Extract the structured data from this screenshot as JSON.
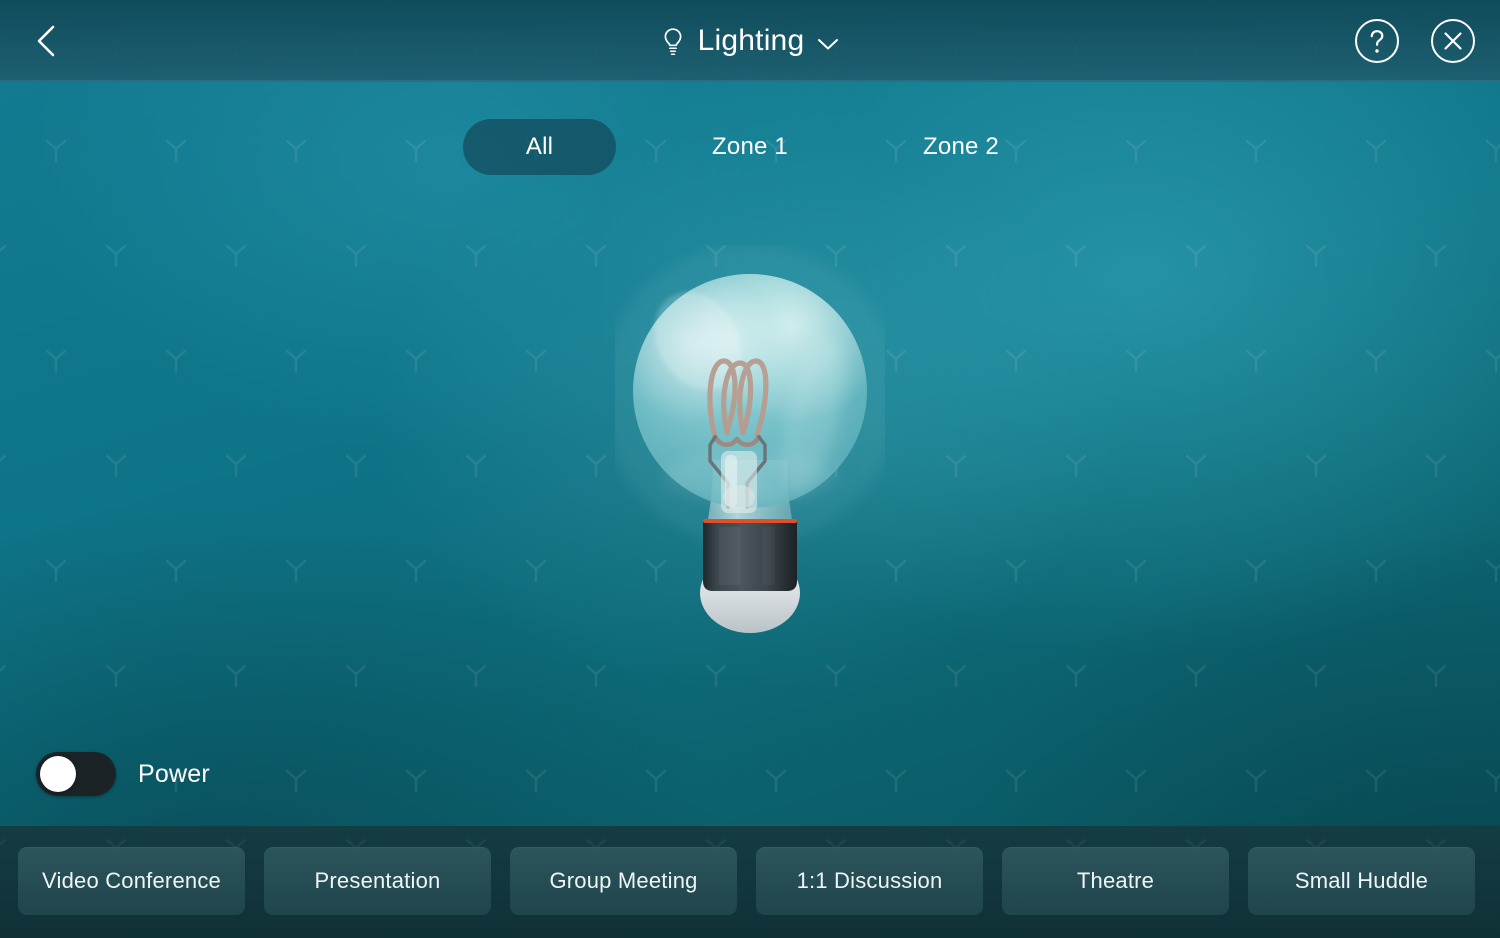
{
  "header": {
    "back_icon": "chevron-left-icon",
    "title_icon": "lightbulb-icon",
    "title": "Lighting",
    "dropdown_icon": "chevron-down-icon",
    "help_icon": "help-circle-icon",
    "close_icon": "close-circle-icon"
  },
  "tabs": {
    "active_index": 0,
    "items": [
      {
        "label": "All"
      },
      {
        "label": "Zone 1"
      },
      {
        "label": "Zone 2"
      }
    ]
  },
  "bulb": {
    "name": "lightbulb-illustration",
    "state": "off",
    "glass_color": "#7cc3cc",
    "filament_color": "#b79c8f",
    "base_color": "#343d43",
    "accent_color": "#e2502a",
    "tip_color": "#dfe5e6"
  },
  "power": {
    "label": "Power",
    "state": "off",
    "track_color": "#1b2327",
    "knob_color": "#ffffff"
  },
  "presets": {
    "items": [
      {
        "label": "Video Conference"
      },
      {
        "label": "Presentation"
      },
      {
        "label": "Group Meeting"
      },
      {
        "label": "1:1 Discussion"
      },
      {
        "label": "Theatre"
      },
      {
        "label": "Small Huddle"
      }
    ]
  },
  "theme": {
    "background_top": "#157a92",
    "background_bottom": "#084d58",
    "header_bg": "#1e5c6c",
    "active_tab_bg": "#255a6b",
    "preset_bar_bg": "#123439",
    "preset_button_bg": "#2b545b",
    "text_color": "#ffffff"
  }
}
